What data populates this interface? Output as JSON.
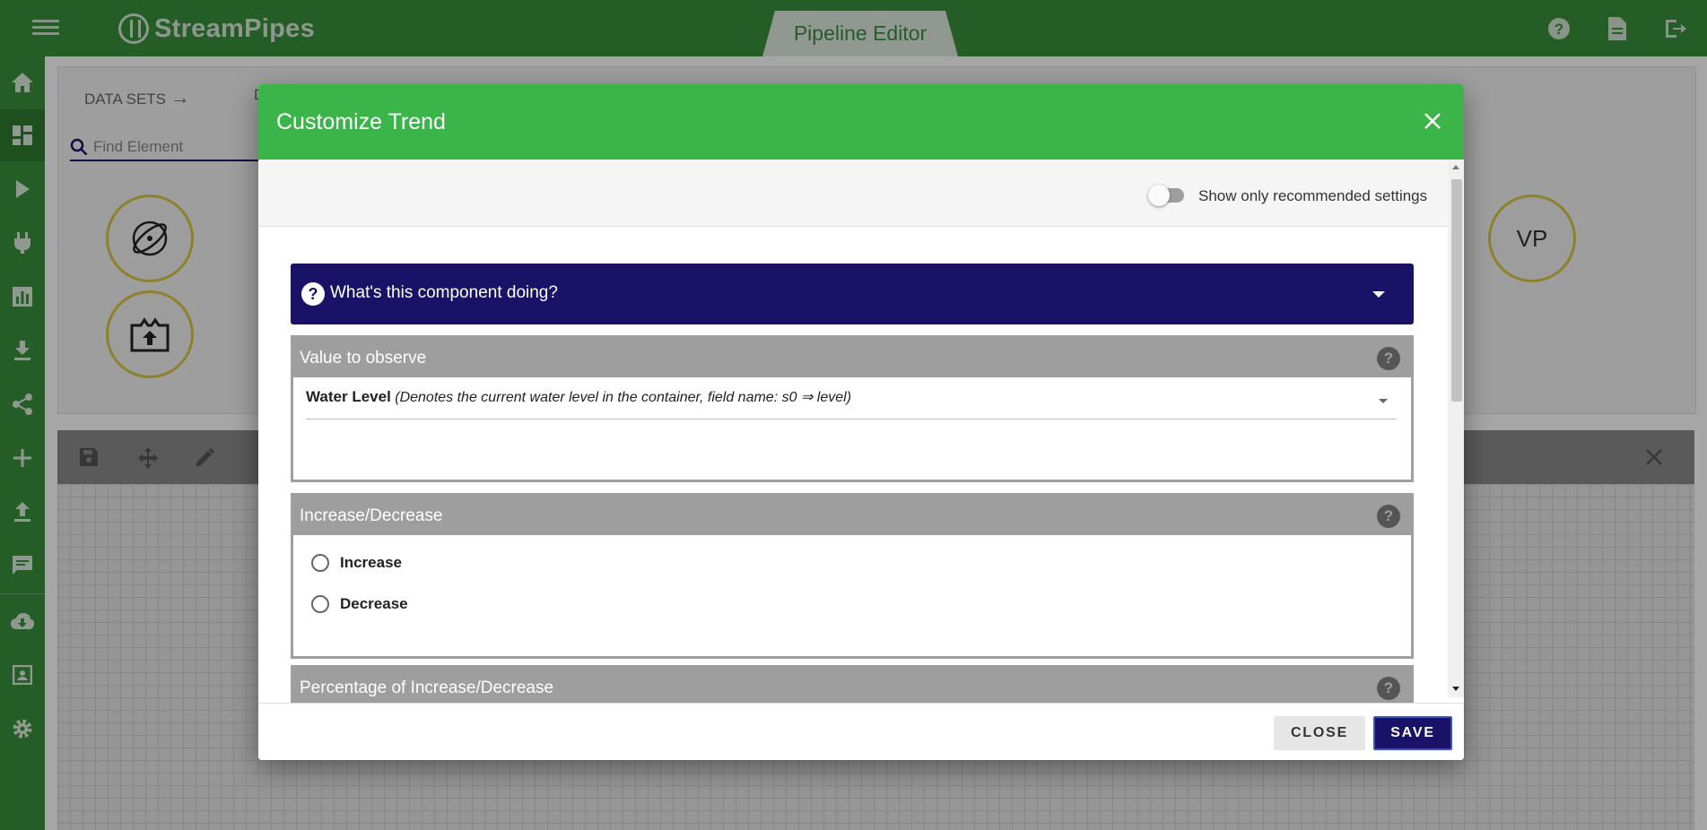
{
  "app": {
    "name": "StreamPipes",
    "active_tab": "Pipeline Editor"
  },
  "sidebar": {
    "items": [
      "home-icon",
      "dashboard-icon",
      "play-icon",
      "plug-icon",
      "chart-icon",
      "download-icon",
      "share-icon",
      "add-icon",
      "upload-icon",
      "chat-icon",
      "cloud-download-icon",
      "account-box-icon",
      "settings-icon"
    ]
  },
  "library": {
    "tab_data_sets": "DATA SETS",
    "tab_partial": "D",
    "search_placeholder": "Find Element",
    "vp_node_label": "VP"
  },
  "dialog": {
    "title": "Customize Trend",
    "toggle_label": "Show only recommended settings",
    "doc_header": "What's this component doing?",
    "sections": {
      "value": {
        "title": "Value to observe",
        "field_name": "Water Level",
        "field_desc": " (Denotes the current water level in the container, field name: s0 ⇒ level)"
      },
      "direction": {
        "title": "Increase/Decrease",
        "option_increase": "Increase",
        "option_decrease": "Decrease"
      },
      "percentage": {
        "title": "Percentage of Increase/Decrease"
      }
    },
    "close_label": "CLOSE",
    "save_label": "SAVE"
  },
  "colors": {
    "brand_green": "#3a8f3c",
    "dialog_header": "#3bb54a",
    "primary_navy": "#1a1266",
    "section_gray": "#9e9e9e"
  }
}
